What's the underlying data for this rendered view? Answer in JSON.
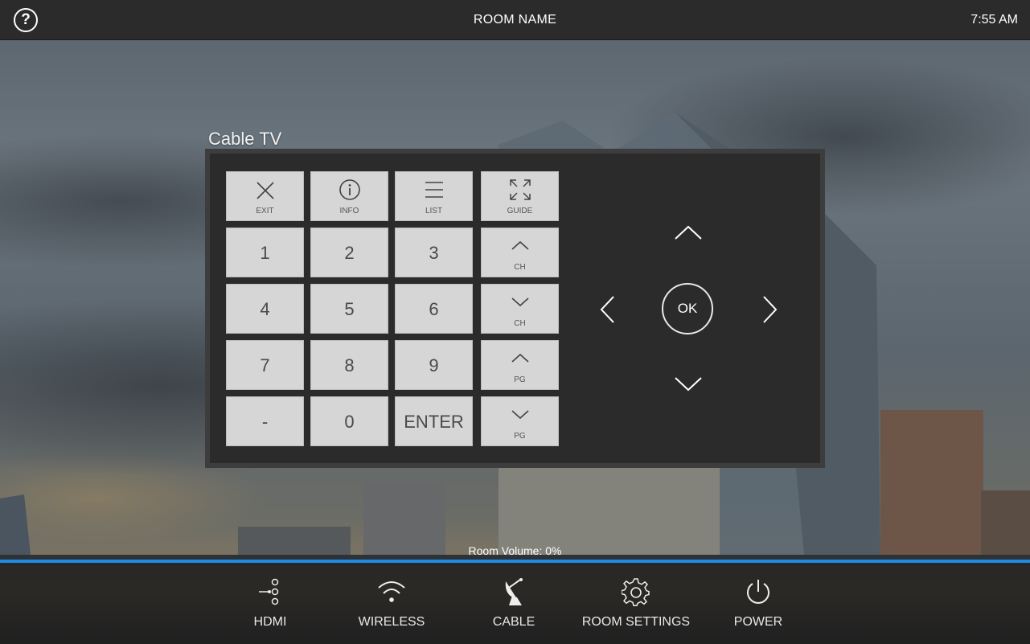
{
  "topbar": {
    "help_label": "?",
    "room_name": "ROOM NAME",
    "time": "7:55 AM"
  },
  "panel": {
    "title": "Cable TV",
    "keys": {
      "exit": "EXIT",
      "info": "INFO",
      "list": "LIST",
      "guide": "GUIDE",
      "k1": "1",
      "k2": "2",
      "k3": "3",
      "k4": "4",
      "k5": "5",
      "k6": "6",
      "k7": "7",
      "k8": "8",
      "k9": "9",
      "dash": "-",
      "k0": "0",
      "enter": "ENTER",
      "ch_up": "CH",
      "ch_down": "CH",
      "pg_up": "PG",
      "pg_down": "PG"
    },
    "dpad": {
      "ok": "OK"
    }
  },
  "volume": {
    "label": "Room Volume: 0%",
    "level_percent": 0
  },
  "nav": {
    "items": [
      {
        "label": "HDMI",
        "icon": "hdmi-icon"
      },
      {
        "label": "WIRELESS",
        "icon": "wifi-icon"
      },
      {
        "label": "CABLE",
        "icon": "satellite-dish-icon"
      },
      {
        "label": "ROOM SETTINGS",
        "icon": "gear-icon"
      },
      {
        "label": "POWER",
        "icon": "power-icon"
      }
    ]
  },
  "colors": {
    "accent": "#1e8de0",
    "topbar": "#2b2b2b",
    "key_bg": "#d6d6d6"
  }
}
